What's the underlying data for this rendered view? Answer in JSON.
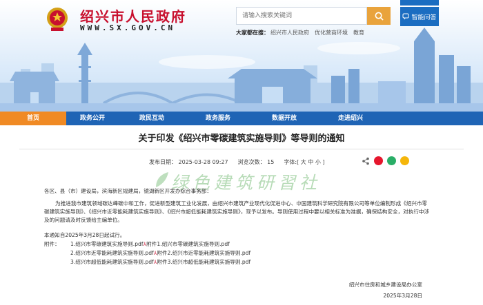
{
  "header": {
    "site_title": "绍兴市人民政府",
    "site_url": "WWW.SX.GOV.CN",
    "search_placeholder": "请输入搜索关键词",
    "access_label": "智能问答",
    "hot_label": "大家都在搜：",
    "hot_links": [
      "绍兴市人民政府",
      "优化营商环境",
      "教育"
    ]
  },
  "nav": {
    "items": [
      {
        "label": "首页",
        "active": true
      },
      {
        "label": "政务公开",
        "active": false
      },
      {
        "label": "政民互动",
        "active": false
      },
      {
        "label": "政务服务",
        "active": false
      },
      {
        "label": "数据开放",
        "active": false
      },
      {
        "label": "走进绍兴",
        "active": false
      }
    ]
  },
  "article": {
    "title": "关于印发《绍兴市零碳建筑实施导则》等导则的通知",
    "publish_time": "发布日期： 2025-03-28 09:27",
    "views": "浏览次数： 15",
    "font_size": "字体:[ 大 中 小 ]",
    "watermark": "绿色建筑研習社",
    "greeting": "各区、县（市）建设局，滨海新区规建局，镜湖新区开发办综合事务部：",
    "main_paragraph": "为推进我市建筑领域碳达峰碳中和工作，促进新型建筑工业化发展，由绍兴市建筑产业现代化促进中心、中国建筑科学研究院有限公司等单位编制形成《绍兴市零碳建筑实施导则》、《绍兴市近零能耗建筑实施导则》、《绍兴市超低能耗建筑实施导则》，现予以发布。导则使用过程中要以相关标准为准据，确保结构安全，对执行中涉及的问题请及时反馈给主编单位。",
    "date_note": "本通知自2025年3月28日起试行。",
    "attachments_label": "附件：",
    "attachments": [
      "1.绍兴市零碳建筑实施导则.pdf",
      "2.绍兴市近零能耗建筑实施导则.pdf",
      "3.绍兴市超低能耗建筑实施导则.pdf"
    ],
    "attachment_links": [
      "附件1.绍兴市零碳建筑实施导则.pdf",
      "附件2.绍兴市近零能耗建筑实施导则.pdf",
      "附件3.绍兴市超低能耗建筑实施导则.pdf"
    ],
    "sign_org": "绍兴市住房和城乡建设局办公室",
    "sign_date": "2025年3月28日"
  },
  "colors": {
    "brand_red": "#c8102e",
    "nav_blue": "#1f64b5",
    "nav_active": "#f08a24",
    "search_orange": "#e9a33c"
  },
  "icons": {
    "emblem": "national-emblem-icon",
    "search": "search-icon",
    "access": "speech-bubble-icon",
    "share": [
      "weibo-icon",
      "wechat-icon",
      "qzone-icon"
    ]
  }
}
